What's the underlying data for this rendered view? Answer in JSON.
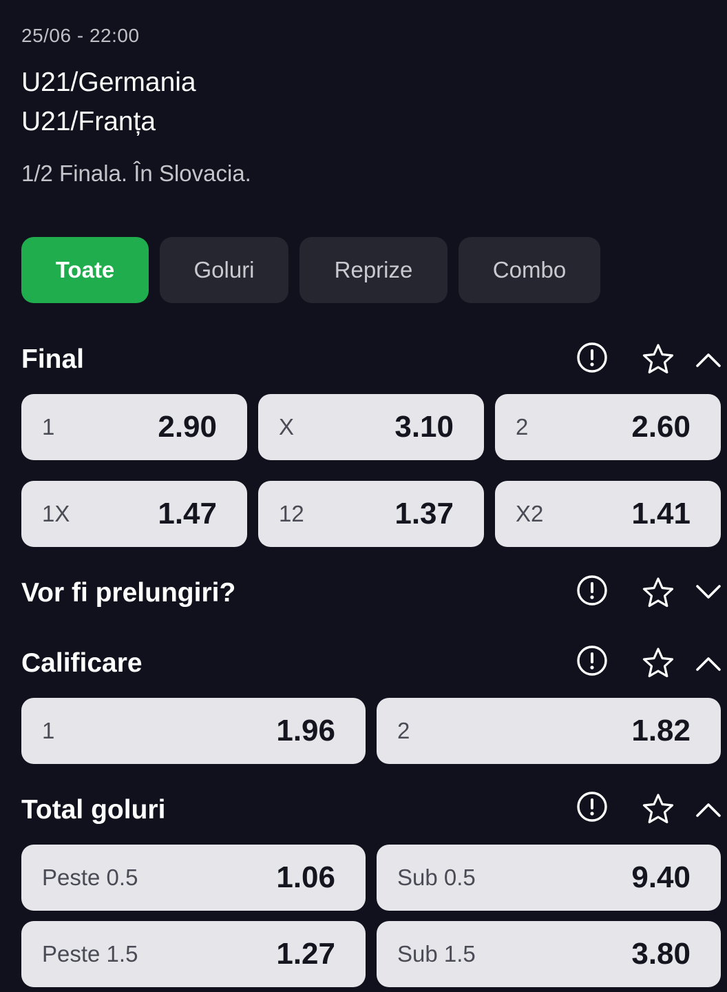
{
  "match": {
    "datetime": "25/06 - 22:00",
    "home_team": "U21/Germania",
    "away_team": "U21/Franța",
    "info": "1/2 Finala. În Slovacia."
  },
  "tabs": [
    {
      "label": "Toate",
      "active": true
    },
    {
      "label": "Goluri",
      "active": false
    },
    {
      "label": "Reprize",
      "active": false
    },
    {
      "label": "Combo",
      "active": false
    }
  ],
  "icons": {
    "info": "info-circle-icon",
    "favorite": "star-outline-icon",
    "expanded": "chevron-up-icon",
    "collapsed": "chevron-down-icon"
  },
  "colors": {
    "background": "#11111d",
    "tab_active": "#1fad4e",
    "tab_inactive": "#262630",
    "odd_button": "#e6e6ea"
  },
  "markets": [
    {
      "title": "Final",
      "expanded": true,
      "odds": [
        {
          "label": "1",
          "value": "2.90"
        },
        {
          "label": "X",
          "value": "3.10"
        },
        {
          "label": "2",
          "value": "2.60"
        },
        {
          "label": "1X",
          "value": "1.47"
        },
        {
          "label": "12",
          "value": "1.37"
        },
        {
          "label": "X2",
          "value": "1.41"
        }
      ]
    },
    {
      "title": "Vor fi prelungiri?",
      "expanded": false,
      "odds": []
    },
    {
      "title": "Calificare",
      "expanded": true,
      "odds": [
        {
          "label": "1",
          "value": "1.96"
        },
        {
          "label": "2",
          "value": "1.82"
        }
      ]
    },
    {
      "title": "Total goluri",
      "expanded": true,
      "odds": [
        {
          "label": "Peste 0.5",
          "value": "1.06"
        },
        {
          "label": "Sub 0.5",
          "value": "9.40"
        },
        {
          "label": "Peste 1.5",
          "value": "1.27"
        },
        {
          "label": "Sub 1.5",
          "value": "3.80"
        }
      ]
    }
  ]
}
